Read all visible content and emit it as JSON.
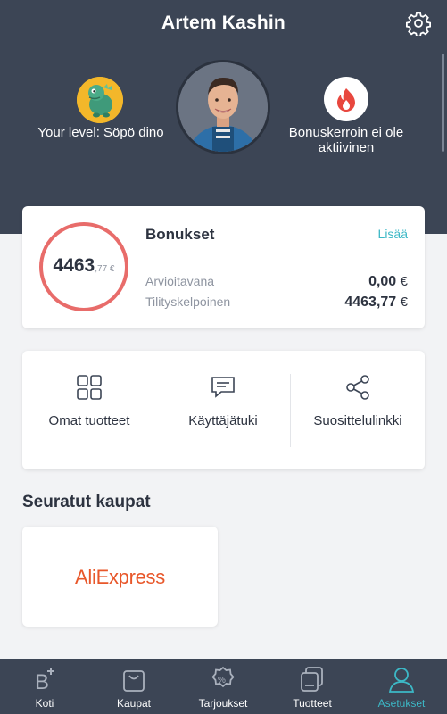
{
  "header": {
    "title": "Artem Kashin",
    "settings_icon": "gear-icon"
  },
  "profile": {
    "level_text": "Your level: Söpö dino",
    "level_icon": "dino-badge-icon",
    "bonus_multiplier_text": "Bonuskerroin ei ole aktiivinen",
    "bonus_multiplier_icon": "fire-icon"
  },
  "bonus": {
    "title": "Bonukset",
    "more_link": "Lisää",
    "ring_value_main": "4463",
    "ring_value_cents": ",77 €",
    "rows": [
      {
        "label": "Arvioitavana",
        "value": "0,00",
        "currency": "€"
      },
      {
        "label": "Tilityskelpoinen",
        "value": "4463,77",
        "currency": "€"
      }
    ],
    "ring_color": "#e86c6a"
  },
  "actions": [
    {
      "label": "Omat tuotteet",
      "icon": "grid-icon"
    },
    {
      "label": "Käyttäjätuki",
      "icon": "chat-icon"
    },
    {
      "label": "Suosittelulinkki",
      "icon": "share-icon"
    }
  ],
  "followed_shops": {
    "title": "Seuratut kaupat",
    "shops": [
      {
        "name": "AliExpress"
      }
    ]
  },
  "tabbar": {
    "tabs": [
      {
        "label": "Koti",
        "icon": "home-b-plus-icon",
        "active": false
      },
      {
        "label": "Kaupat",
        "icon": "shopping-bag-icon",
        "active": false
      },
      {
        "label": "Tarjoukset",
        "icon": "discount-badge-icon",
        "active": false
      },
      {
        "label": "Tuotteet",
        "icon": "products-icon",
        "active": false
      },
      {
        "label": "Asetukset",
        "icon": "user-icon",
        "active": true
      }
    ]
  },
  "colors": {
    "header_bg": "#3c4555",
    "accent": "#3cb8c6",
    "ring": "#e86c6a",
    "brand_aliexpress": "#e8572a"
  }
}
